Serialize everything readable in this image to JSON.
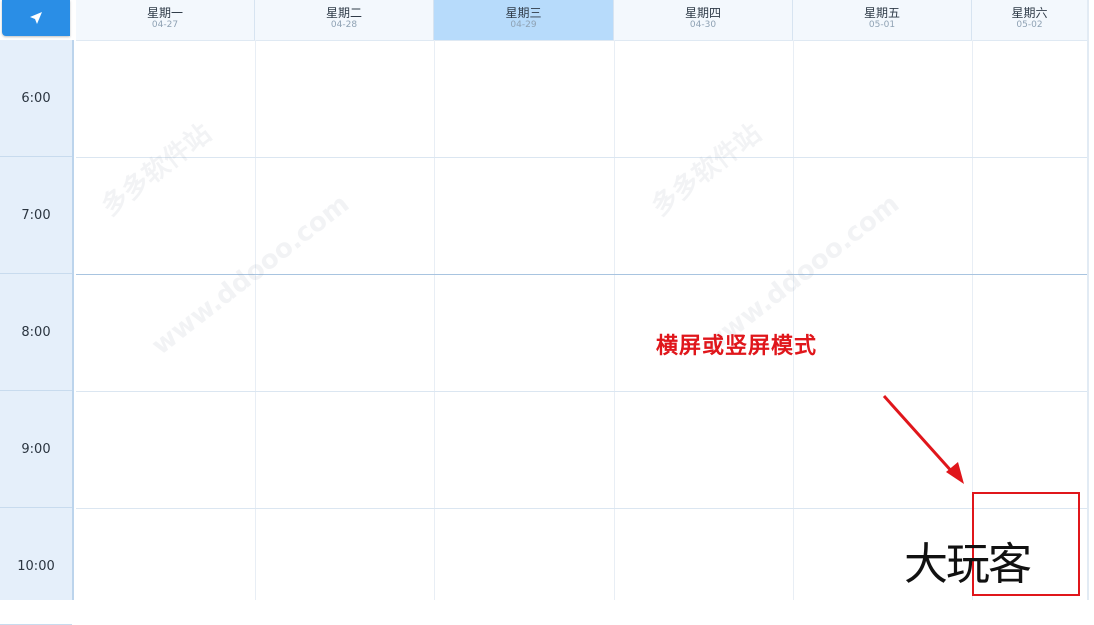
{
  "header": {
    "nav_icon": "navigation-arrow-icon",
    "days": [
      {
        "name": "星期一",
        "date": "04-27",
        "current": false
      },
      {
        "name": "星期二",
        "date": "04-28",
        "current": false
      },
      {
        "name": "星期三",
        "date": "04-29",
        "current": true
      },
      {
        "name": "星期四",
        "date": "04-30",
        "current": false
      },
      {
        "name": "星期五",
        "date": "05-01",
        "current": false
      },
      {
        "name": "星期六",
        "date": "05-02",
        "current": false
      }
    ]
  },
  "time_slots": [
    "6:00",
    "7:00",
    "8:00",
    "9:00",
    "10:00"
  ],
  "watermark": {
    "text_cn": "多多软件站",
    "text_url": "www.ddooo.com"
  },
  "annotation": {
    "label": "横屏或竖屏模式"
  },
  "site_logo": {
    "text": "大玩客"
  },
  "colors": {
    "accent": "#2a8ee6",
    "current_day": "#b7dbfb",
    "annotation_red": "#e0161b",
    "time_column": "#e5effa"
  }
}
